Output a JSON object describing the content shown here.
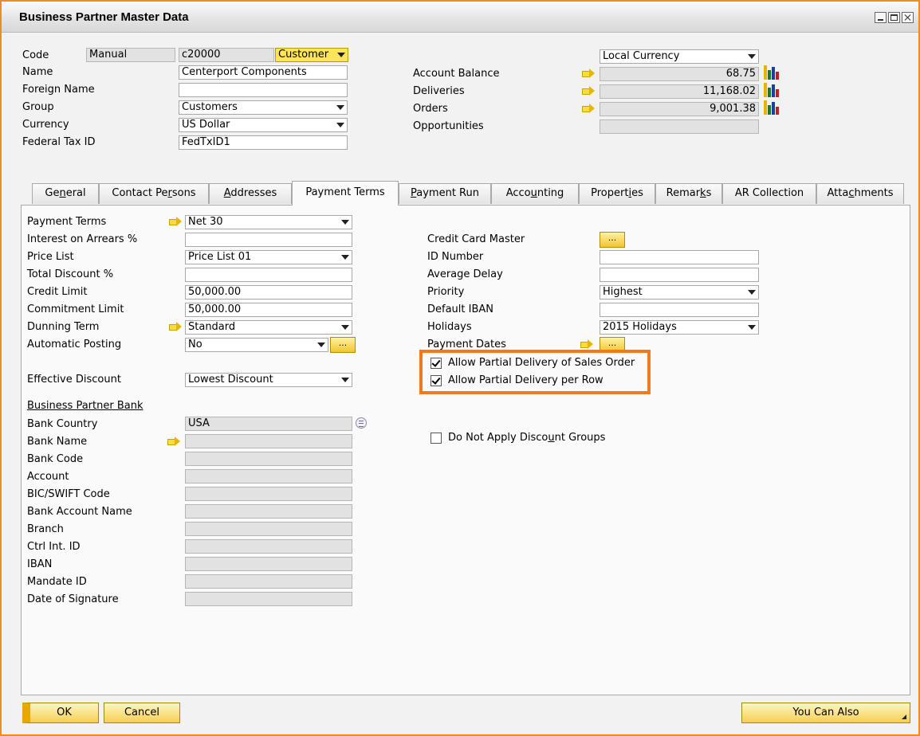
{
  "window": {
    "title": "Business Partner Master Data"
  },
  "header": {
    "code_label": "Code",
    "code_series": "Manual",
    "code_value": "c20000",
    "bp_type": "Customer",
    "name_label": "Name",
    "name_value": "Centerport Components",
    "foreign_name_label": "Foreign Name",
    "foreign_name_value": "",
    "group_label": "Group",
    "group_value": "Customers",
    "currency_label": "Currency",
    "currency_value": "US Dollar",
    "federal_tax_label": "Federal Tax ID",
    "federal_tax_value": "FedTxID1",
    "currency_mode": "Local Currency",
    "account_balance_label": "Account Balance",
    "account_balance_value": "68.75",
    "deliveries_label": "Deliveries",
    "deliveries_value": "11,168.02",
    "orders_label": "Orders",
    "orders_value": "9,001.38",
    "opportunities_label": "Opportunities",
    "opportunities_value": ""
  },
  "tabs": [
    {
      "pre": "Ge",
      "ul": "n",
      "post": "eral"
    },
    {
      "pre": "Contact Pe",
      "ul": "r",
      "post": "sons"
    },
    {
      "pre": "",
      "ul": "A",
      "post": "ddresses"
    },
    {
      "pre": "Payment Terms",
      "ul": "",
      "post": ""
    },
    {
      "pre": "",
      "ul": "P",
      "post": "ayment Run"
    },
    {
      "pre": "Acco",
      "ul": "u",
      "post": "nting"
    },
    {
      "pre": "Propert",
      "ul": "i",
      "post": "es"
    },
    {
      "pre": "Remar",
      "ul": "k",
      "post": "s"
    },
    {
      "pre": "AR Collection",
      "ul": "",
      "post": ""
    },
    {
      "pre": "Atta",
      "ul": "c",
      "post": "hments"
    }
  ],
  "payment_terms": {
    "payment_terms_label": "Payment Terms",
    "payment_terms_value": "Net 30",
    "interest_label": "Interest on Arrears %",
    "interest_value": "",
    "price_list_label": "Price List",
    "price_list_value": "Price List 01",
    "total_discount_label": "Total Discount %",
    "total_discount_value": "",
    "credit_limit_label": "Credit Limit",
    "credit_limit_value": "50,000.00",
    "commitment_limit_label": "Commitment Limit",
    "commitment_limit_value": "50,000.00",
    "dunning_term_label": "Dunning Term",
    "dunning_term_value": "Standard",
    "automatic_posting_label": "Automatic Posting",
    "automatic_posting_value": "No",
    "effective_discount_label": "Effective Discount",
    "effective_discount_value": "Lowest Discount",
    "bp_bank_heading": "Business Partner Bank",
    "bank_country_label": "Bank Country",
    "bank_country_value": "USA",
    "bank_name_label": "Bank Name",
    "bank_code_label": "Bank Code",
    "account_label": "Account",
    "bic_label": "BIC/SWIFT Code",
    "bank_account_name_label": "Bank Account Name",
    "branch_label": "Branch",
    "ctrl_int_label": "Ctrl Int. ID",
    "iban_label": "IBAN",
    "mandate_label": "Mandate ID",
    "date_signature_label": "Date of Signature",
    "credit_card_master_label": "Credit Card Master",
    "id_number_label": "ID Number",
    "id_number_value": "",
    "average_delay_label": "Average Delay",
    "average_delay_value": "",
    "priority_label": "Priority",
    "priority_value": "Highest",
    "default_iban_label": "Default IBAN",
    "default_iban_value": "",
    "holidays_label": "Holidays",
    "holidays_value": "2015 Holidays",
    "payment_dates_label": "Payment Dates",
    "allow_partial_so_label": "Allow Partial Delivery of Sales Order",
    "allow_partial_so_checked": true,
    "allow_partial_row_label": "Allow Partial Delivery per Row",
    "allow_partial_row_checked": true,
    "no_discount_groups_pre": "Do Not Apply Disco",
    "no_discount_groups_ul": "u",
    "no_discount_groups_post": "nt Groups",
    "no_discount_groups_checked": false,
    "ellipsis": "..."
  },
  "footer": {
    "ok_label": "OK",
    "cancel_label": "Cancel",
    "you_can_also_label": "You Can Also"
  }
}
